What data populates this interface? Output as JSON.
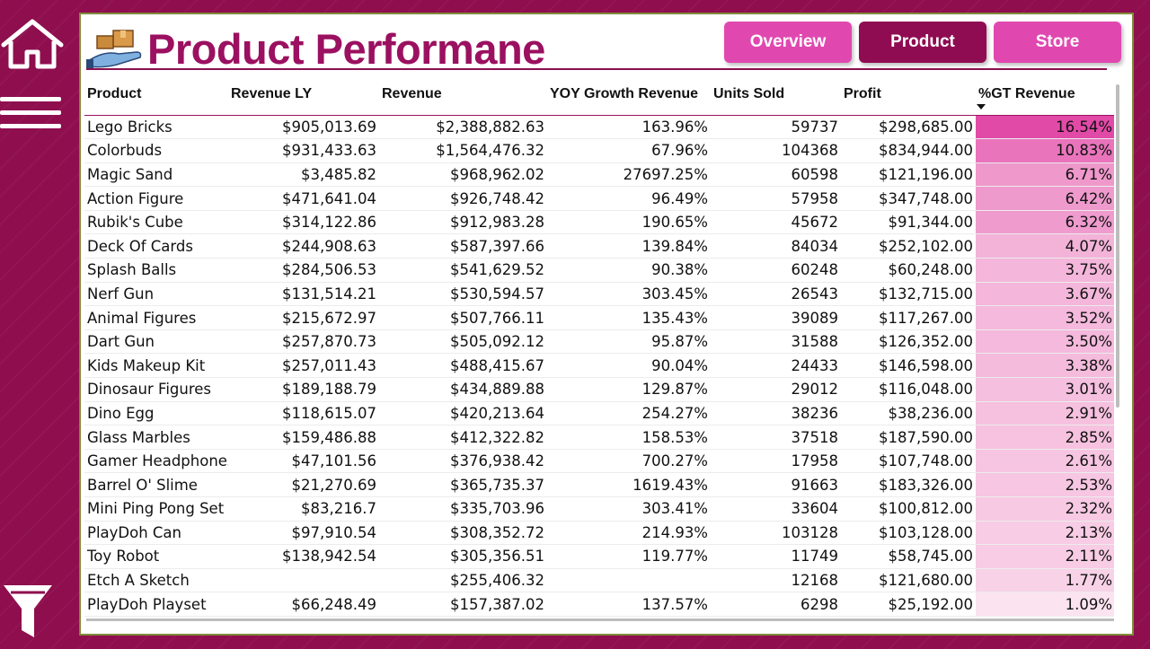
{
  "sidebar": {
    "home_icon": "home-icon",
    "menu_icon": "hamburger-menu-icon",
    "filter_icon": "funnel-filter-icon"
  },
  "header": {
    "title": "Product Performane",
    "logo_icon": "hand-holding-box-icon",
    "title_color": "#9b1060"
  },
  "nav": {
    "overview": "Overview",
    "product": "Product",
    "store": "Store",
    "active": "Product",
    "button_color": "#e048b0",
    "active_color": "#8f0c52"
  },
  "table": {
    "columns": [
      "Product",
      "Revenue LY",
      "Revenue",
      "YOY Growth Revenue",
      "Units Sold",
      "Profit",
      "%GT Revenue"
    ],
    "sort_column": "%GT Revenue",
    "sort_direction": "descending",
    "gt_color_max": "#e24aa8",
    "gt_color_min": "#fbe3ef",
    "rows": [
      {
        "product": "Lego Bricks",
        "revenue_ly": "$905,013.69",
        "revenue": "$2,388,882.63",
        "yoy": "163.96%",
        "units": "59737",
        "profit": "$298,685.00",
        "gt": "16.54%",
        "gt_value": 16.54
      },
      {
        "product": "Colorbuds",
        "revenue_ly": "$931,433.63",
        "revenue": "$1,564,476.32",
        "yoy": "67.96%",
        "units": "104368",
        "profit": "$834,944.00",
        "gt": "10.83%",
        "gt_value": 10.83
      },
      {
        "product": "Magic Sand",
        "revenue_ly": "$3,485.82",
        "revenue": "$968,962.02",
        "yoy": "27697.25%",
        "units": "60598",
        "profit": "$121,196.00",
        "gt": "6.71%",
        "gt_value": 6.71
      },
      {
        "product": "Action Figure",
        "revenue_ly": "$471,641.04",
        "revenue": "$926,748.42",
        "yoy": "96.49%",
        "units": "57958",
        "profit": "$347,748.00",
        "gt": "6.42%",
        "gt_value": 6.42
      },
      {
        "product": "Rubik's Cube",
        "revenue_ly": "$314,122.86",
        "revenue": "$912,983.28",
        "yoy": "190.65%",
        "units": "45672",
        "profit": "$91,344.00",
        "gt": "6.32%",
        "gt_value": 6.32
      },
      {
        "product": "Deck Of Cards",
        "revenue_ly": "$244,908.63",
        "revenue": "$587,397.66",
        "yoy": "139.84%",
        "units": "84034",
        "profit": "$252,102.00",
        "gt": "4.07%",
        "gt_value": 4.07
      },
      {
        "product": "Splash Balls",
        "revenue_ly": "$284,506.53",
        "revenue": "$541,629.52",
        "yoy": "90.38%",
        "units": "60248",
        "profit": "$60,248.00",
        "gt": "3.75%",
        "gt_value": 3.75
      },
      {
        "product": "Nerf Gun",
        "revenue_ly": "$131,514.21",
        "revenue": "$530,594.57",
        "yoy": "303.45%",
        "units": "26543",
        "profit": "$132,715.00",
        "gt": "3.67%",
        "gt_value": 3.67
      },
      {
        "product": "Animal Figures",
        "revenue_ly": "$215,672.97",
        "revenue": "$507,766.11",
        "yoy": "135.43%",
        "units": "39089",
        "profit": "$117,267.00",
        "gt": "3.52%",
        "gt_value": 3.52
      },
      {
        "product": "Dart Gun",
        "revenue_ly": "$257,870.73",
        "revenue": "$505,092.12",
        "yoy": "95.87%",
        "units": "31588",
        "profit": "$126,352.00",
        "gt": "3.50%",
        "gt_value": 3.5
      },
      {
        "product": "Kids Makeup Kit",
        "revenue_ly": "$257,011.43",
        "revenue": "$488,415.67",
        "yoy": "90.04%",
        "units": "24433",
        "profit": "$146,598.00",
        "gt": "3.38%",
        "gt_value": 3.38
      },
      {
        "product": "Dinosaur Figures",
        "revenue_ly": "$189,188.79",
        "revenue": "$434,889.88",
        "yoy": "129.87%",
        "units": "29012",
        "profit": "$116,048.00",
        "gt": "3.01%",
        "gt_value": 3.01
      },
      {
        "product": "Dino Egg",
        "revenue_ly": "$118,615.07",
        "revenue": "$420,213.64",
        "yoy": "254.27%",
        "units": "38236",
        "profit": "$38,236.00",
        "gt": "2.91%",
        "gt_value": 2.91
      },
      {
        "product": "Glass Marbles",
        "revenue_ly": "$159,486.88",
        "revenue": "$412,322.82",
        "yoy": "158.53%",
        "units": "37518",
        "profit": "$187,590.00",
        "gt": "2.85%",
        "gt_value": 2.85
      },
      {
        "product": "Gamer Headphones",
        "revenue_ly": "$47,101.56",
        "revenue": "$376,938.42",
        "yoy": "700.27%",
        "units": "17958",
        "profit": "$107,748.00",
        "gt": "2.61%",
        "gt_value": 2.61
      },
      {
        "product": "Barrel O' Slime",
        "revenue_ly": "$21,270.69",
        "revenue": "$365,735.37",
        "yoy": "1619.43%",
        "units": "91663",
        "profit": "$183,326.00",
        "gt": "2.53%",
        "gt_value": 2.53
      },
      {
        "product": "Mini Ping Pong Set",
        "revenue_ly": "$83,216.7",
        "revenue": "$335,703.96",
        "yoy": "303.41%",
        "units": "33604",
        "profit": "$100,812.00",
        "gt": "2.32%",
        "gt_value": 2.32
      },
      {
        "product": "PlayDoh Can",
        "revenue_ly": "$97,910.54",
        "revenue": "$308,352.72",
        "yoy": "214.93%",
        "units": "103128",
        "profit": "$103,128.00",
        "gt": "2.13%",
        "gt_value": 2.13
      },
      {
        "product": "Toy Robot",
        "revenue_ly": "$138,942.54",
        "revenue": "$305,356.51",
        "yoy": "119.77%",
        "units": "11749",
        "profit": "$58,745.00",
        "gt": "2.11%",
        "gt_value": 2.11
      },
      {
        "product": "Etch A Sketch",
        "revenue_ly": "",
        "revenue": "$255,406.32",
        "yoy": "",
        "units": "12168",
        "profit": "$121,680.00",
        "gt": "1.77%",
        "gt_value": 1.77
      },
      {
        "product": "PlayDoh Playset",
        "revenue_ly": "$66,248.49",
        "revenue": "$157,387.02",
        "yoy": "137.57%",
        "units": "6298",
        "profit": "$25,192.00",
        "gt": "1.09%",
        "gt_value": 1.09
      }
    ]
  }
}
